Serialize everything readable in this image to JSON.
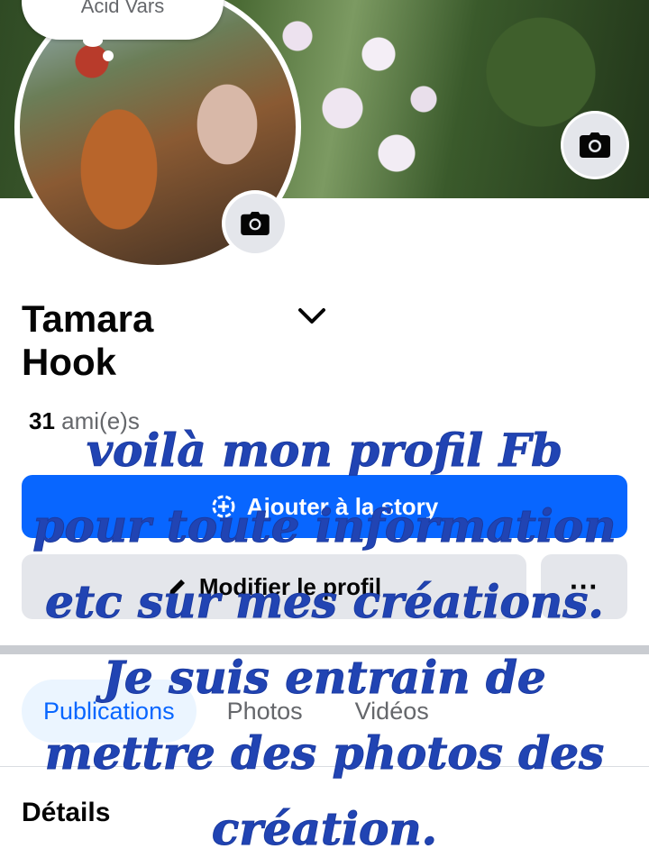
{
  "status_bubble": {
    "text": "Acid Vars"
  },
  "profile": {
    "name": "Tamara Hook",
    "friends_count": "31",
    "friends_label": "ami(e)s"
  },
  "buttons": {
    "add_story": "Ajouter à la story",
    "edit_profile": "Modifier le profil",
    "more": "···"
  },
  "tabs": [
    {
      "label": "Publications",
      "active": true
    },
    {
      "label": "Photos",
      "active": false
    },
    {
      "label": "Vidéos",
      "active": false
    }
  ],
  "section": {
    "details": "Détails"
  },
  "overlay_text": [
    "voilà mon profil Fb",
    "pour toute information",
    "etc sur mes créations.",
    "Je suis entrain de",
    "mettre des photos des",
    "création."
  ],
  "colors": {
    "primary": "#0866ff",
    "overlay": "#2144b3",
    "gray_button": "#e4e6eb"
  },
  "icons": [
    "camera-icon",
    "chevron-down-icon",
    "story-add-icon",
    "pencil-icon",
    "more-icon"
  ]
}
